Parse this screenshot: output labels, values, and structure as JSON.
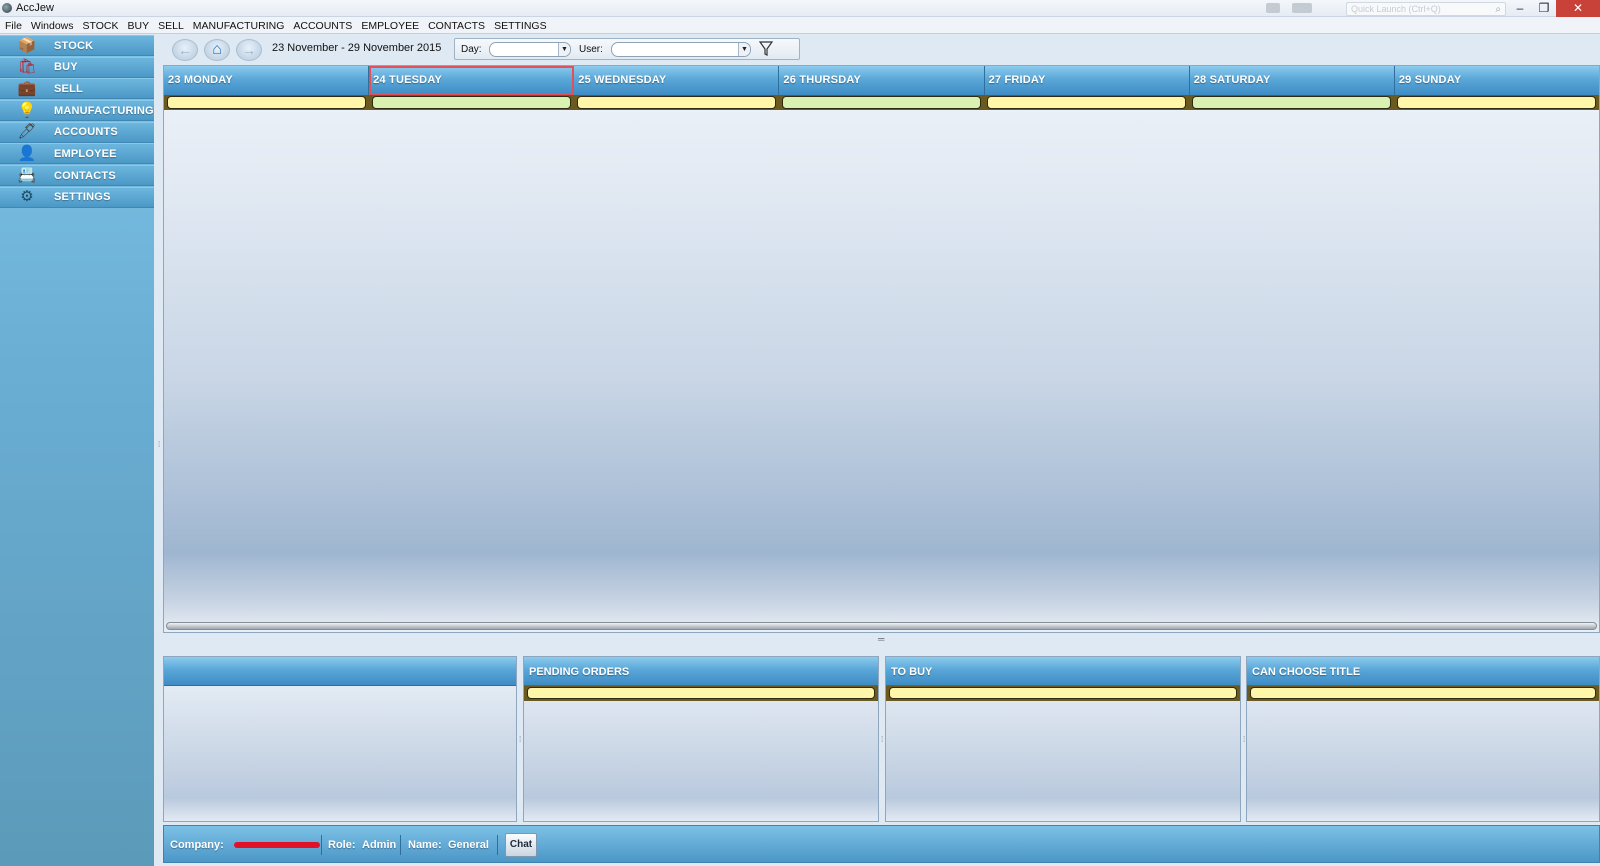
{
  "window": {
    "title": "AccJew",
    "search_placeholder": "Quick Launch (Ctrl+Q)",
    "minimize": "–",
    "restore": "❐",
    "close": "✕"
  },
  "menu": [
    "File",
    "Windows",
    "STOCK",
    "BUY",
    "SELL",
    "MANUFACTURING",
    "ACCOUNTS",
    "EMPLOYEE",
    "CONTACTS",
    "SETTINGS"
  ],
  "sidebar": {
    "items": [
      {
        "label": "STOCK",
        "icon": "stock-icon",
        "glyph": "📦",
        "color": "#b0b8c2"
      },
      {
        "label": "BUY",
        "icon": "buy-icon",
        "glyph": "🛍",
        "color": "#c0202a"
      },
      {
        "label": "SELL",
        "icon": "sell-icon",
        "glyph": "💼",
        "color": "#111111"
      },
      {
        "label": "MANUFACTURING",
        "icon": "lightbulb-icon",
        "glyph": "💡",
        "color": "#f0d020"
      },
      {
        "label": "ACCOUNTS",
        "icon": "accounts-icon",
        "glyph": "🖊",
        "color": "#444444"
      },
      {
        "label": "EMPLOYEE",
        "icon": "employee-icon",
        "glyph": "👤",
        "color": "#222222"
      },
      {
        "label": "CONTACTS",
        "icon": "contacts-icon",
        "glyph": "📇",
        "color": "#888888"
      },
      {
        "label": "SETTINGS",
        "icon": "settings-icon",
        "glyph": "⚙",
        "color": "#1d4a63"
      }
    ]
  },
  "toolbar": {
    "back_icon": "←",
    "home_icon": "⌂",
    "forward_icon": "→",
    "date_range": "23 November - 29 November 2015",
    "day_label": "Day:",
    "day_value": "",
    "user_label": "User:",
    "user_value": "",
    "filter_icon": "⏷"
  },
  "calendar": {
    "days": [
      {
        "label": "23  MONDAY",
        "bar": "yellow",
        "today": false
      },
      {
        "label": "24  TUESDAY",
        "bar": "green",
        "today": true
      },
      {
        "label": "25  WEDNESDAY",
        "bar": "yellow",
        "today": false
      },
      {
        "label": "26  THURSDAY",
        "bar": "green",
        "today": false
      },
      {
        "label": "27  FRIDAY",
        "bar": "yellow",
        "today": false
      },
      {
        "label": "28  SATURDAY",
        "bar": "green",
        "today": false
      },
      {
        "label": "29  SUNDAY",
        "bar": "yellow",
        "today": false
      }
    ]
  },
  "panels": [
    {
      "title": "",
      "has_bar": false
    },
    {
      "title": "PENDING ORDERS",
      "has_bar": true
    },
    {
      "title": "TO BUY",
      "has_bar": true
    },
    {
      "title": "CAN CHOOSE TITLE",
      "has_bar": true
    }
  ],
  "status": {
    "company_label": "Company:",
    "role_label": "Role:",
    "role_value": "Admin",
    "name_label": "Name:",
    "name_value": "General",
    "chat_label": "Chat"
  }
}
